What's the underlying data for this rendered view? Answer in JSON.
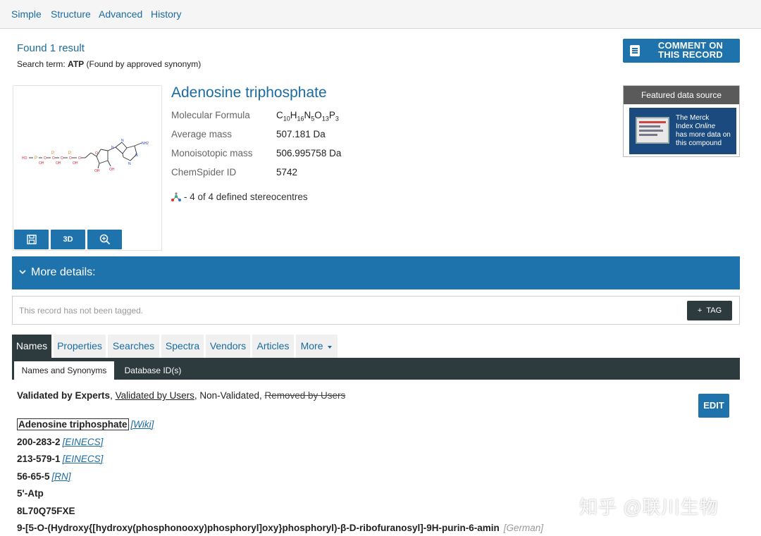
{
  "nav": {
    "items": [
      "Simple",
      "Structure",
      "Advanced",
      "History"
    ]
  },
  "result": {
    "found": "Found 1 result",
    "search_prefix": "Search term:",
    "search_term": "ATP",
    "search_note": "(Found by approved synonym)"
  },
  "comment_button": {
    "line1": "COMMENT ON",
    "line2": "THIS RECORD",
    "icon": "document-icon"
  },
  "structure": {
    "buttons": {
      "save": "save-icon",
      "three_d": "3D",
      "zoom": "zoom-in-icon"
    },
    "atom_labels": [
      "HO",
      "P",
      "O",
      "OH",
      "O",
      "P",
      "O",
      "OH",
      "O",
      "P",
      "O",
      "OH",
      "O",
      "N",
      "N",
      "NH2",
      "N",
      "N",
      "OH",
      "OH",
      "O"
    ]
  },
  "compound": {
    "title": "Adenosine triphosphate",
    "properties": [
      {
        "label": "Molecular Formula",
        "formula": [
          [
            "C",
            "10"
          ],
          [
            "H",
            "16"
          ],
          [
            "N",
            "5"
          ],
          [
            "O",
            "13"
          ],
          [
            "P",
            "3"
          ]
        ]
      },
      {
        "label": "Average mass",
        "value": "507.181 Da"
      },
      {
        "label": "Monoisotopic mass",
        "value": "506.995758 Da"
      },
      {
        "label": "ChemSpider ID",
        "value": "5742"
      }
    ],
    "stereo": "- 4 of 4 defined stereocentres"
  },
  "featured": {
    "header": "Featured data source",
    "ad_line1": "The Merck",
    "ad_line2_prefix": "Index ",
    "ad_line2_em": "Online",
    "ad_line3": "has more data on",
    "ad_line4": "this compound"
  },
  "more_details": {
    "label": "More details:",
    "icon": "chevron-down-icon"
  },
  "tags": {
    "placeholder": "This record has not been tagged.",
    "button": "TAG",
    "button_icon": "plus-icon"
  },
  "tabs": [
    "Names",
    "Properties",
    "Searches",
    "Spectra",
    "Vendors",
    "Articles",
    "More"
  ],
  "subtabs": [
    "Names and Synonyms",
    "Database ID(s)"
  ],
  "validation": {
    "experts": "Validated by Experts",
    "users": "Validated by Users",
    "non": "Non-Validated",
    "removed": "Removed by Users"
  },
  "edit_button": "EDIT",
  "names": [
    {
      "name": "Adenosine triphosphate",
      "ref": "[Wiki]",
      "lang": ""
    },
    {
      "name": "200-283-2",
      "ref": "[EINECS]",
      "lang": ""
    },
    {
      "name": "213-579-1",
      "ref": "[EINECS]",
      "lang": ""
    },
    {
      "name": "56-65-5",
      "ref": "[RN]",
      "lang": ""
    },
    {
      "name": "5'-Atp",
      "ref": "",
      "lang": ""
    },
    {
      "name": "8L70Q75FXE",
      "ref": "",
      "lang": ""
    },
    {
      "name": "9-[5-O-(Hydroxy{[hydroxy(phosphonooxy)phosphoryl]oxy}phosphoryl)-β-D-ribofuranosyl]-9H-purin-6-amin",
      "ref": "",
      "lang": "[German]"
    }
  ],
  "watermark": "知乎 @联川生物",
  "colors": {
    "brand_blue": "#1f73ad",
    "link_blue": "#1a6ba0",
    "dark_tab": "#2d3a3e",
    "featured_header": "#5a5a5a"
  }
}
